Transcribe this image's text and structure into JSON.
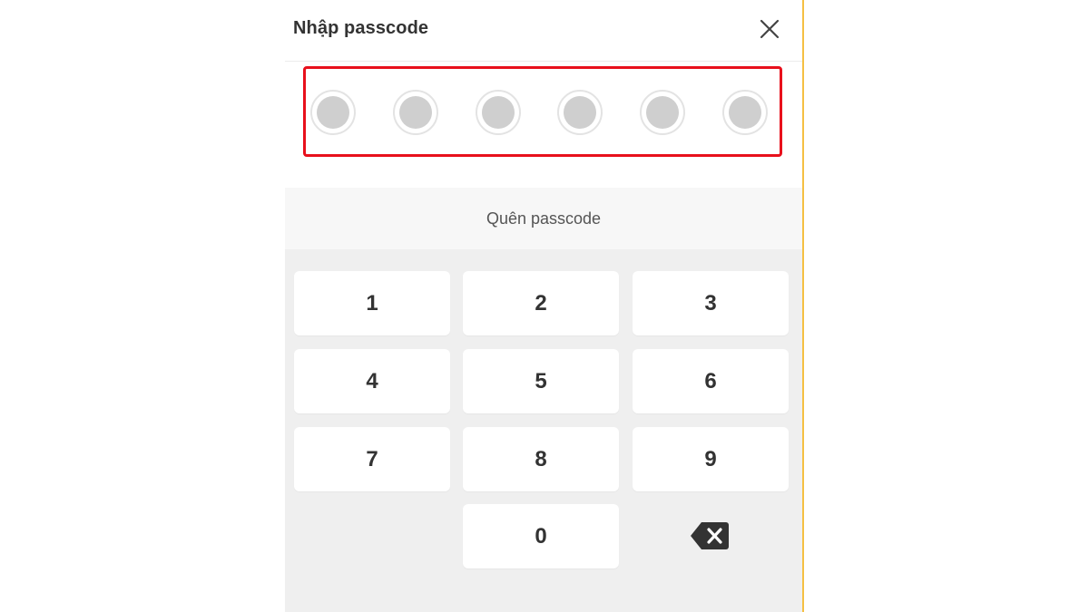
{
  "header": {
    "title": "Nhập passcode",
    "close_icon": "close-icon"
  },
  "passcode": {
    "length": 6,
    "filled": 0
  },
  "forgot": {
    "label": "Quên passcode"
  },
  "keypad": {
    "keys": [
      "1",
      "2",
      "3",
      "4",
      "5",
      "6",
      "7",
      "8",
      "9",
      "0"
    ],
    "backspace_icon": "backspace-icon"
  },
  "colors": {
    "accent_border": "#f5c043",
    "highlight": "#e8101c",
    "dot_fill": "#cfcfcf",
    "keypad_bg": "#efefef"
  }
}
